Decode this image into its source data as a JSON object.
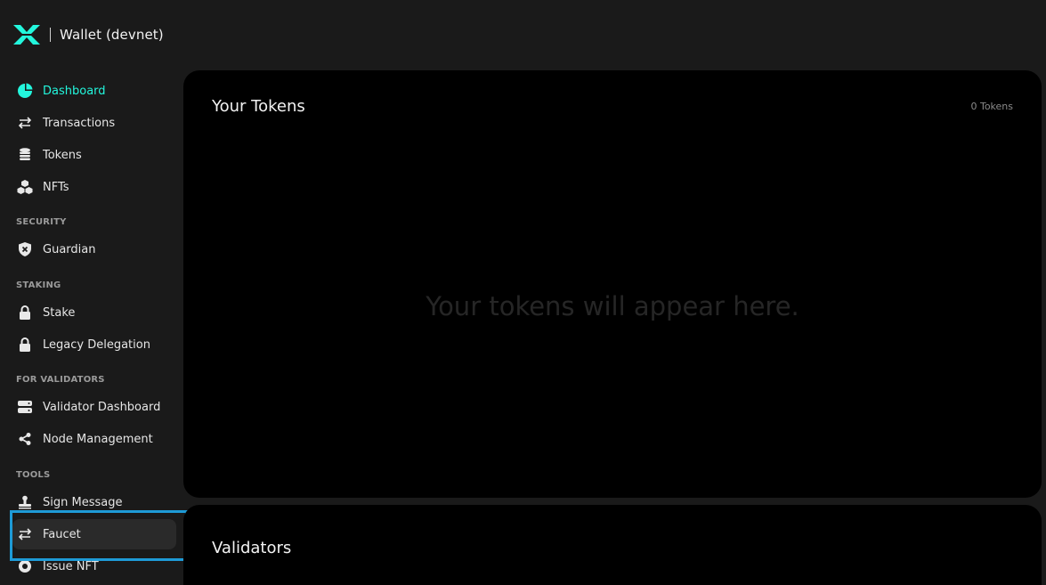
{
  "app": {
    "title": "Wallet (devnet)",
    "accent_color": "#23f7dd",
    "highlight_color": "#1e9bd7"
  },
  "sidebar": {
    "main_items": [
      {
        "label": "Dashboard",
        "icon": "pie-chart-icon",
        "active": true
      },
      {
        "label": "Transactions",
        "icon": "arrows-swap-icon"
      },
      {
        "label": "Tokens",
        "icon": "coins-icon"
      },
      {
        "label": "NFTs",
        "icon": "cubes-icon"
      }
    ],
    "sections": [
      {
        "title": "SECURITY",
        "items": [
          {
            "label": "Guardian",
            "icon": "shield-icon"
          }
        ]
      },
      {
        "title": "STAKING",
        "items": [
          {
            "label": "Stake",
            "icon": "lock-icon"
          },
          {
            "label": "Legacy Delegation",
            "icon": "lock-icon"
          }
        ]
      },
      {
        "title": "FOR VALIDATORS",
        "items": [
          {
            "label": "Validator Dashboard",
            "icon": "server-icon"
          },
          {
            "label": "Node Management",
            "icon": "share-nodes-icon"
          }
        ]
      },
      {
        "title": "TOOLS",
        "items": [
          {
            "label": "Sign Message",
            "icon": "stamp-icon"
          },
          {
            "label": "Faucet",
            "icon": "arrows-swap-icon",
            "selected": true
          },
          {
            "label": "Issue NFT",
            "icon": "badge-icon"
          }
        ]
      }
    ]
  },
  "tokens_panel": {
    "title": "Your Tokens",
    "count": "0 Tokens",
    "empty_message": "Your tokens will appear here."
  },
  "validators_panel": {
    "title": "Validators"
  }
}
